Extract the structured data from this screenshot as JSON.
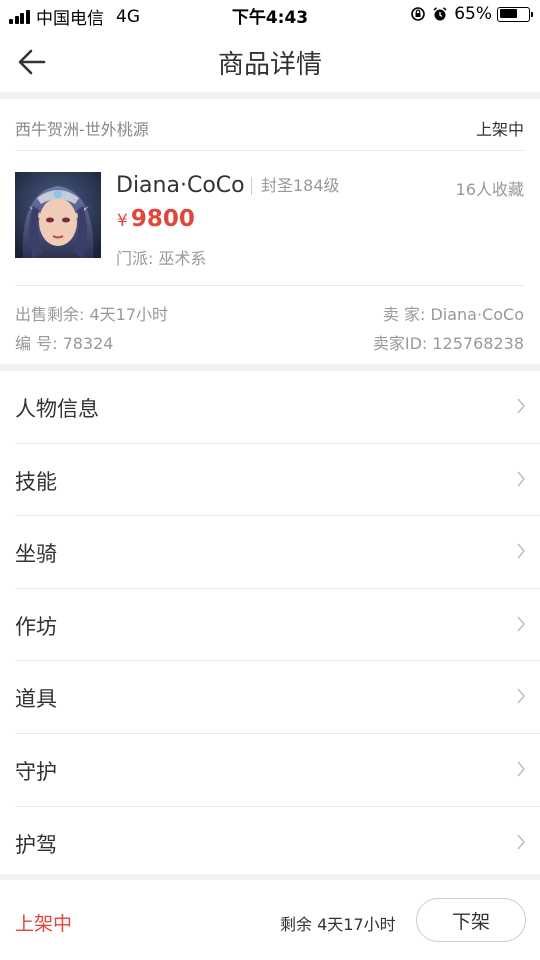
{
  "status_bar": {
    "carrier": "中国电信",
    "network": "4G",
    "time": "下午4:43",
    "battery": "65%",
    "battery_fraction": 0.65,
    "icons": [
      "signal-icon",
      "orientation-lock-icon",
      "alarm-icon",
      "battery-icon"
    ]
  },
  "nav": {
    "title": "商品详情",
    "back_icon": "back-arrow-icon"
  },
  "listing": {
    "server": "西牛贺洲-世外桃源",
    "status": "上架中",
    "character_name": "Diana·CoCo",
    "level": "封圣184级",
    "favorites": "16人收藏",
    "currency_symbol": "¥",
    "price": "9800",
    "school": "门派: 巫术系",
    "remaining_label": "出售剩余: 4天17小时",
    "seller_label": "卖  家: Diana·CoCo",
    "serial_label": "编  号: 78324",
    "seller_id_label": "卖家ID: 125768238"
  },
  "menu": {
    "items": [
      {
        "label": "人物信息"
      },
      {
        "label": "技能"
      },
      {
        "label": "坐骑"
      },
      {
        "label": "作坊"
      },
      {
        "label": "道具"
      },
      {
        "label": "守护"
      },
      {
        "label": "护驾"
      }
    ],
    "chevron_icon": "chevron-right-icon"
  },
  "footer": {
    "status": "上架中",
    "remaining": "剩余 4天17小时",
    "delist_label": "下架"
  },
  "colors": {
    "accent_red": "#e2463a",
    "divider": "#e8e8e8",
    "page_gap": "#f2f2f2",
    "muted_text": "#999999"
  }
}
